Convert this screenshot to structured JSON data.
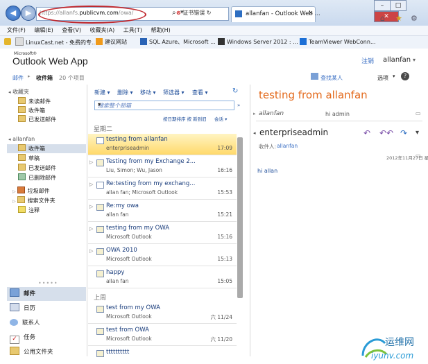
{
  "browser": {
    "url_dim": "https://allanfs.",
    "url_host": "publicvm.com",
    "url_path": "/owa/",
    "cert_error": "证书错误",
    "tab_title": "allanfan - Outlook Web ..."
  },
  "menu": [
    "文件(F)",
    "编辑(E)",
    "查看(V)",
    "收藏夹(A)",
    "工具(T)",
    "帮助(H)"
  ],
  "favorites": [
    {
      "label": "LinuxCast.net - 免费的专..."
    },
    {
      "label": "建议网站"
    },
    {
      "label": "SQL Azure、Microsoft ..."
    },
    {
      "label": "Windows Server 2012 : ..."
    },
    {
      "label": "TeamViewer WebConn..."
    }
  ],
  "owa": {
    "logo_small": "Microsoft®",
    "logo": "Outlook Web App",
    "signout": "注销",
    "user": "allanfan",
    "find_people": "查找某人",
    "options": "选项"
  },
  "breadcrumb": {
    "mail": "邮件",
    "folder": "收件箱",
    "count": "20 个项目"
  },
  "folders": {
    "favorites_header": "收藏夹",
    "favorites": [
      "未读邮件",
      "收件箱",
      "已发送邮件"
    ],
    "account_header": "allanfan",
    "items": [
      "收件箱",
      "草稿",
      "已发送邮件",
      "已删除邮件",
      "垃圾邮件",
      "搜索文件夹",
      "注释"
    ]
  },
  "nav": [
    "邮件",
    "日历",
    "联系人",
    "任务",
    "公用文件夹"
  ],
  "list": {
    "toolbar": [
      "新建 ▾",
      "删除 ▾",
      "移动 ▾",
      "筛选器 ▾",
      "查看 ▾"
    ],
    "search_placeholder": "搜索整个邮箱",
    "sort_label": "按日期排序 按 新到旧",
    "conversation_label": "会话 ▾",
    "group1": "星期二",
    "group2": "上周",
    "messages": [
      {
        "subject": "testing from allanfan",
        "from": "enterpriseadmin",
        "time": "17:09"
      },
      {
        "subject": "Testing from my Exchange 2...",
        "from": "Liu, Simon; Wu, Jason",
        "time": "16:16"
      },
      {
        "subject": "Re:testing from my exchang...",
        "from": "allan fan; Microsoft Outlook",
        "time": "15:53"
      },
      {
        "subject": "Re:my owa",
        "from": "allan fan",
        "time": "15:21"
      },
      {
        "subject": "testing from my OWA",
        "from": "Microsoft Outlook",
        "time": "15:16"
      },
      {
        "subject": "OWA 2010",
        "from": "Microsoft Outlook",
        "time": "15:13"
      },
      {
        "subject": "happy",
        "from": "allan fan",
        "time": "15:05"
      }
    ],
    "messages2": [
      {
        "subject": "test from my OWA",
        "from": "Microsoft Outlook",
        "time": "六 11/24"
      },
      {
        "subject": "test from OWA",
        "from": "Microsoft Outlook",
        "time": "六 11/20"
      },
      {
        "subject": "tttttttttt",
        "from": "",
        "time": ""
      }
    ]
  },
  "reading": {
    "title": "testing from allanfan",
    "sender1": "allanfan",
    "preview1": "hi admin",
    "sender2": "enterpriseadmin",
    "to_label": "收件人:",
    "to": "allanfan",
    "date": "2012年11月27日 星",
    "body": "hi allan"
  },
  "watermark": {
    "text": "运维网",
    "url": "iyunv.com"
  }
}
